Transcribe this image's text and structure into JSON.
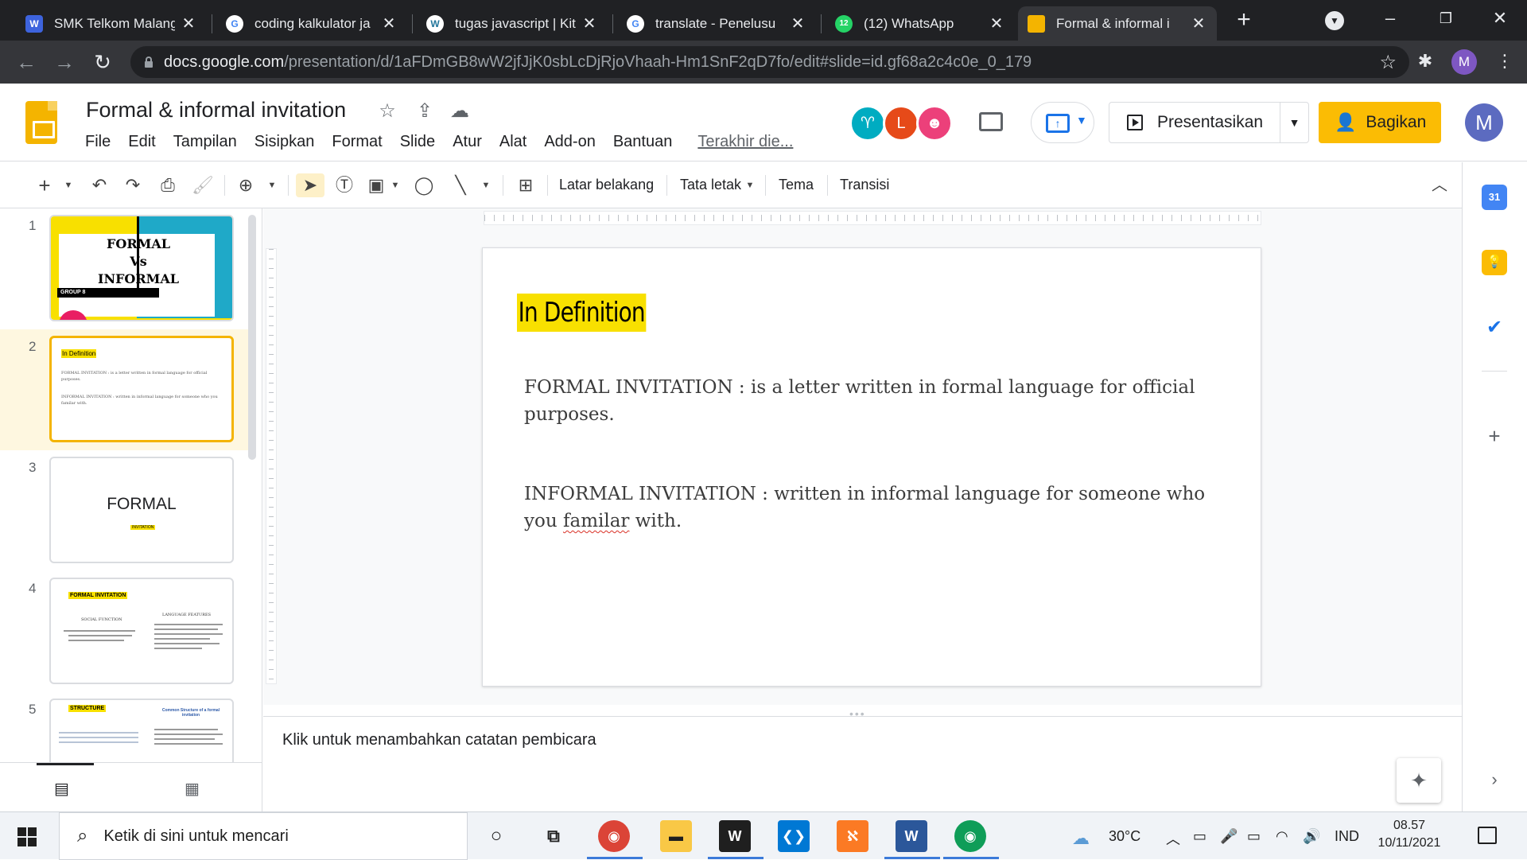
{
  "browser": {
    "tabs": [
      {
        "title": "SMK Telkom Malang",
        "favicon": "w-logo-icon",
        "color": "#4f7ef7"
      },
      {
        "title": "coding kalkulator ja",
        "favicon": "google-icon",
        "color": "#ffffff"
      },
      {
        "title": "tugas javascript | Kit",
        "favicon": "wordpress-icon",
        "color": "#ffffff"
      },
      {
        "title": "translate - Penelusu",
        "favicon": "google-icon",
        "color": "#ffffff"
      },
      {
        "title": "(12) WhatsApp",
        "favicon": "whatsapp-icon",
        "color": "#25d366",
        "badge": "12"
      },
      {
        "title": "Formal & informal i",
        "favicon": "slides-icon",
        "color": "#f4b400"
      }
    ],
    "url_host": "docs.google.com",
    "url_path": "/presentation/d/1aFDmGB8wW2jfJjK0sbLcDjRjoVhaah-Hm1SnF2qD7fo/edit#slide=id.gf68a2c4c0e_0_179",
    "profile_initial": "M"
  },
  "app": {
    "doc_title": "Formal & informal invitation",
    "menu": [
      "File",
      "Edit",
      "Tampilan",
      "Sisipkan",
      "Format",
      "Slide",
      "Atur",
      "Alat",
      "Add-on",
      "Bantuan"
    ],
    "last_edit": "Terakhir die...",
    "collaborators": [
      {
        "initial": "",
        "color": "#00acc1",
        "icon": "goat-avatar"
      },
      {
        "initial": "L",
        "color": "#e64a19"
      },
      {
        "initial": "",
        "color": "#ec407a",
        "icon": "cat-avatar"
      }
    ],
    "present_label": "Presentasikan",
    "share_label": "Bagikan",
    "user_initial": "M"
  },
  "toolbar": {
    "background": "Latar belakang",
    "layout": "Tata letak",
    "theme": "Tema",
    "transition": "Transisi"
  },
  "filmstrip": {
    "numbers": [
      "1",
      "2",
      "3",
      "4",
      "5"
    ],
    "slide1": {
      "title_lines": [
        "FORMAL",
        "Vs",
        "INFORMAL"
      ],
      "group": "GROUP 8"
    },
    "slide2": {
      "title": "In Definition",
      "p1": "FORMAL INVITATION :   is a letter written in formal language for official purposes.",
      "p2": "INFORMAL INVITATION :  written in informal language for someone who you familar with."
    },
    "slide3": {
      "title": "FORMAL",
      "sub": "INVITATION"
    },
    "slide4": {
      "title": "FORMAL INVITATION",
      "col1": "SOCIAL FUNCTION",
      "col2": "LANGUAGE FEATURES"
    },
    "slide5": {
      "title": "STRUCTURE",
      "sub": "Common Structure of a formal invitation"
    }
  },
  "slide": {
    "title": "In Definition",
    "para1_a": "FORMAL INVITATION :   is a letter written in formal language for official purposes.",
    "para2_a": "INFORMAL INVITATION :  written in informal language for someone who you ",
    "para2_b": "familar",
    "para2_c": " with."
  },
  "notes_placeholder": "Klik untuk menambahkan catatan pembicara",
  "taskbar": {
    "search_placeholder": "Ketik di sini untuk mencari",
    "temperature": "30°C",
    "lang": "IND",
    "time": "08.57",
    "date": "10/11/2021"
  },
  "colors": {
    "accent_yellow": "#f8e000",
    "slides_yellow": "#f4b400",
    "share": "#fbbc04"
  }
}
